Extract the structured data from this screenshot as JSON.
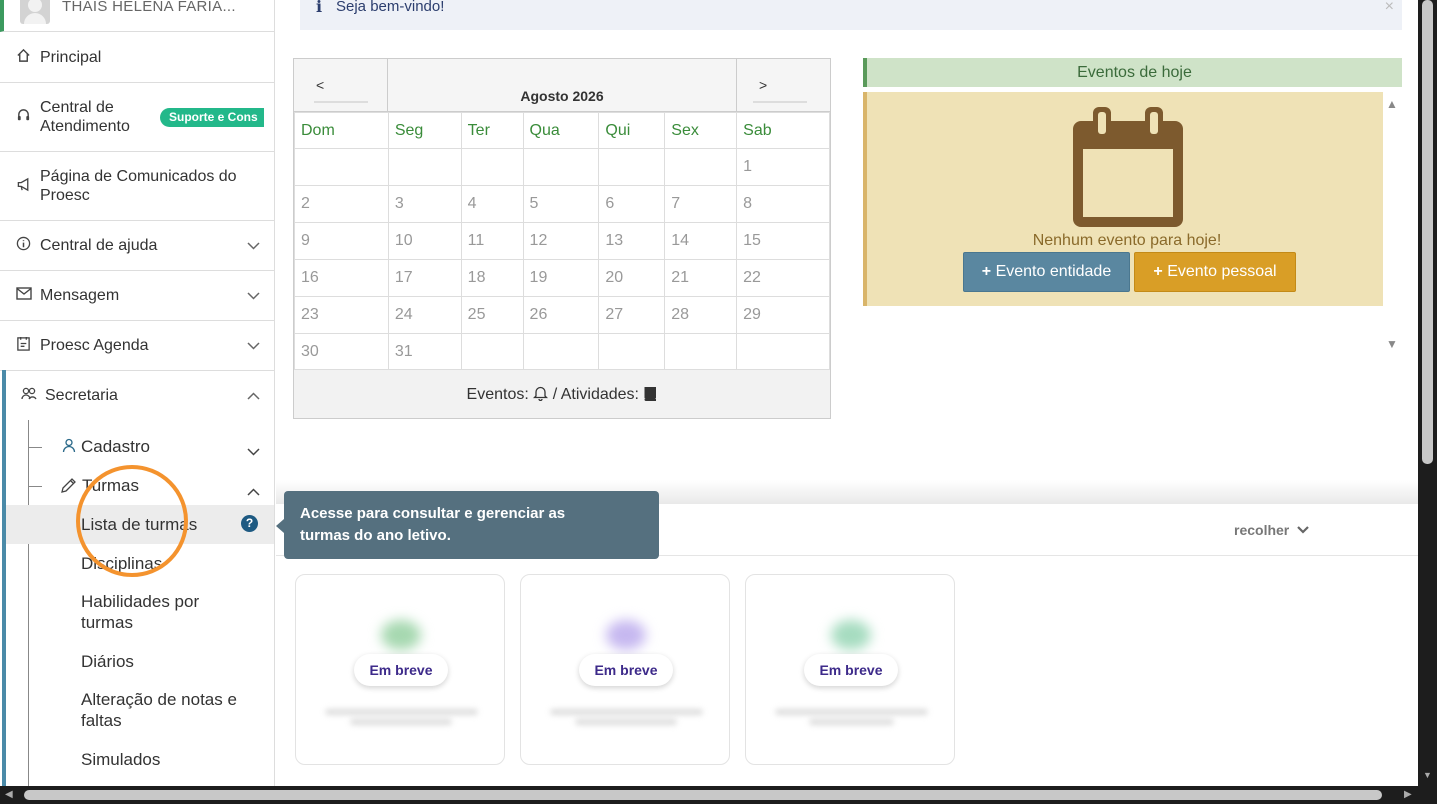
{
  "user": {
    "name": "THAIS HELENA FARIA..."
  },
  "sidebar": {
    "items": [
      {
        "label": "Principal",
        "icon": "home-icon"
      },
      {
        "label": "Central de\nAtendimento",
        "badge": "Suporte e Cons",
        "icon": "headset-icon"
      },
      {
        "label": "Página de Comunicados do Proesc",
        "icon": "megaphone-icon"
      },
      {
        "label": "Central de ajuda",
        "icon": "info-icon"
      },
      {
        "label": "Mensagem",
        "icon": "mail-icon"
      },
      {
        "label": "Proesc Agenda",
        "icon": "agenda-icon"
      },
      {
        "label": "Secretaria",
        "icon": "users-icon"
      }
    ],
    "sub": {
      "cadastro": "Cadastro",
      "turmas": "Turmas",
      "leaves": [
        "Lista de turmas",
        "Disciplinas",
        "Habilidades por turmas",
        "Diários",
        "Alteração de notas e faltas",
        "Simulados"
      ]
    }
  },
  "alert": {
    "icon": "i",
    "message": "Seja bem-vindo!",
    "close": "×"
  },
  "calendar": {
    "prev": "<",
    "next": ">",
    "title": "Agosto 2026",
    "weekdays": [
      "Dom",
      "Seg",
      "Ter",
      "Qua",
      "Qui",
      "Sex",
      "Sab"
    ],
    "weeks": [
      [
        "",
        "",
        "",
        "",
        "",
        "",
        "1"
      ],
      [
        "2",
        "3",
        "4",
        "5",
        "6",
        "7",
        "8"
      ],
      [
        "9",
        "10",
        "11",
        "12",
        "13",
        "14",
        "15"
      ],
      [
        "16",
        "17",
        "18",
        "19",
        "20",
        "21",
        "22"
      ],
      [
        "23",
        "24",
        "25",
        "26",
        "27",
        "28",
        "29"
      ],
      [
        "30",
        "31",
        "",
        "",
        "",
        "",
        ""
      ]
    ],
    "footer": {
      "eventos": "Eventos:",
      "separator": "/ Atividades:"
    }
  },
  "events": {
    "header": "Eventos de hoje",
    "empty": "Nenhum evento para hoje!",
    "btn_entidade": "Evento entidade",
    "btn_pessoal": "Evento pessoal",
    "plus": "+"
  },
  "tooltip": {
    "line1": "Acesse para consultar e gerenciar as",
    "line2": "turmas do ano letivo."
  },
  "bottom": {
    "recolher": "recolher",
    "cards": [
      {
        "soon": "Em breve",
        "accent": "#a6d8b0"
      },
      {
        "soon": "Em breve",
        "accent": "#c6b8f0"
      },
      {
        "soon": "Em breve",
        "accent": "#a6dcc0"
      }
    ]
  },
  "colors": {
    "accent_green": "#3a8c3a",
    "btn_entidade": "#5a87a0",
    "btn_pessoal": "#d99e26",
    "highlight": "#f4932e"
  }
}
